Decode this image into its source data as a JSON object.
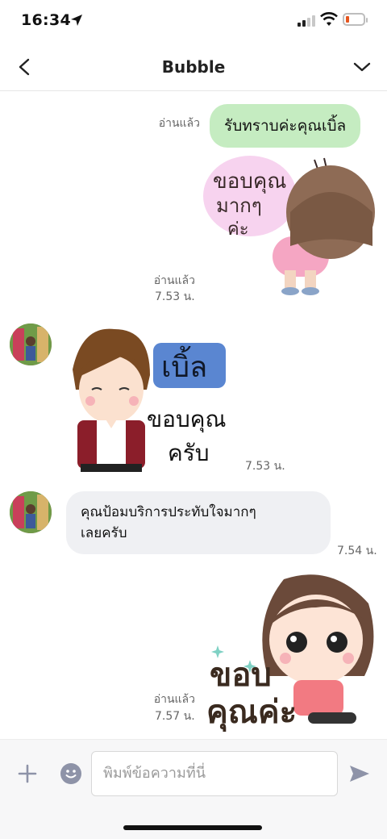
{
  "status_bar": {
    "time": "16:34",
    "battery_color": "#e6561f"
  },
  "header": {
    "title": "Bubble"
  },
  "messages": [
    {
      "type": "text-out",
      "text": "รับทราบค่ะคุณเบิ้ล",
      "read": "อ่านแล้ว",
      "bubble_color": "#c5ecc1"
    },
    {
      "type": "sticker-out",
      "sticker_text": "ขอบคุณ มากๆ ค่ะ",
      "read": "อ่านแล้ว",
      "time": "7.53 น."
    },
    {
      "type": "sticker-in",
      "sticker_text_1": "เบิ้ล",
      "sticker_text_2": "ขอบคุณ",
      "sticker_text_3": "ครับ",
      "time": "7.53 น."
    },
    {
      "type": "text-in",
      "text_line1": "คุณป้อมบริการประทับใจมากๆ",
      "text_line2": "เลยครับ",
      "time": "7.54 น."
    },
    {
      "type": "sticker-out",
      "sticker_text_1": "ขอบ",
      "sticker_text_2": "คุณค่ะ",
      "read": "อ่านแล้ว",
      "time": "7.57 น."
    }
  ],
  "input_bar": {
    "placeholder": "พิมพ์ข้อความที่นี่",
    "accent": "#8e93a8"
  }
}
